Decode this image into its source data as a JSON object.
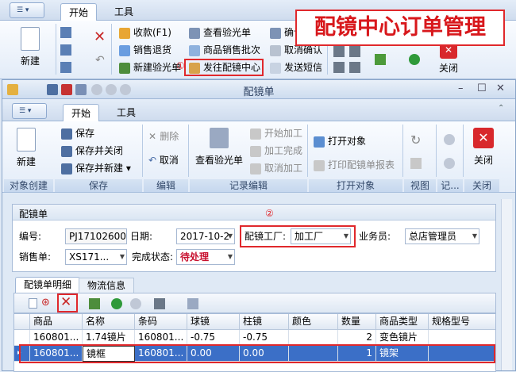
{
  "back_window": {
    "tabs": [
      "开始",
      "工具"
    ],
    "new_label": "新建",
    "close_label": "关闭",
    "buttons": {
      "receive": "收款(F1)",
      "sales_return": "销售退货",
      "new_inspection": "新建验光单",
      "view_inspection": "查看验光单",
      "batch": "商品销售批次",
      "send_to_center": "发往配镜中心",
      "confirm": "确认配",
      "cancel_confirm": "取消确认",
      "send_sms": "发送短信"
    },
    "marker": "①",
    "overlay_title": "配镜中心订单管理"
  },
  "front_window": {
    "title": "配镜单",
    "tabs": [
      "开始",
      "工具"
    ],
    "ribbon": {
      "new": "新建",
      "save": "保存",
      "save_close": "保存并关闭",
      "save_new": "保存并新建",
      "delete": "删除",
      "cancel": "取消",
      "view_inspection": "查看验光单",
      "start_process": "开始加工",
      "process_done": "加工完成",
      "cancel_process": "取消加工",
      "open_object": "打开对象",
      "print_report": "打印配镜单报表",
      "close": "关闭"
    },
    "groups": [
      "对象创建",
      "保存",
      "编辑",
      "记录编辑",
      "打开对象",
      "视图",
      "记...",
      "关闭"
    ],
    "form": {
      "section_title": "配镜单",
      "no_label": "编号:",
      "no_value": "PJ17102600",
      "date_label": "日期:",
      "date_value": "2017-10-2",
      "factory_label": "配镜工厂:",
      "factory_value": "加工厂",
      "salesman_label": "业务员:",
      "salesman_value": "总店管理员",
      "sales_order_label": "销售单:",
      "sales_order_value": "XS171...",
      "status_label": "完成状态:",
      "status_value": "待处理",
      "marker": "②"
    },
    "detail_tabs": [
      "配镜单明细",
      "物流信息"
    ],
    "grid": {
      "columns": [
        "商品",
        "名称",
        "条码",
        "球镜",
        "柱镜",
        "颜色",
        "数量",
        "商品类型",
        "规格型号"
      ],
      "rows": [
        [
          "160801...",
          "1.74镜片",
          "160801...",
          "-0.75",
          "-0.75",
          "",
          "2",
          "变色镜片",
          ""
        ],
        [
          "160801...",
          "镜框",
          "160801...",
          "0.00",
          "0.00",
          "",
          "1",
          "镜架",
          ""
        ]
      ]
    }
  },
  "colors": {
    "accent_red": "#e0282c",
    "selection": "#3b6fc7",
    "status_red": "#c8102e"
  }
}
